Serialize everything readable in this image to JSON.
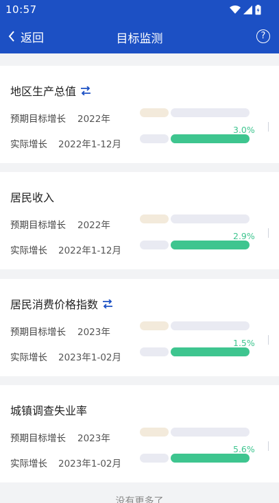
{
  "status_bar": {
    "time": "10:57"
  },
  "header": {
    "back_label": "返回",
    "title": "目标监测",
    "help_symbol": "?"
  },
  "colors": {
    "brand": "#1c50c4",
    "bar_fill": "#3ec58f",
    "target_track": "#f3eadb",
    "track": "#e9eaf2"
  },
  "cards": [
    {
      "title": "地区生产总值",
      "has_indicator": true,
      "target": {
        "label": "预期目标增长",
        "period": "2022年"
      },
      "actual": {
        "label": "实际增长",
        "period": "2022年1-12月",
        "value_text": "3.0%",
        "fill_fraction": 1.0
      }
    },
    {
      "title": "居民收入",
      "has_indicator": false,
      "target": {
        "label": "预期目标增长",
        "period": "2022年"
      },
      "actual": {
        "label": "实际增长",
        "period": "2022年1-12月",
        "value_text": "2.9%",
        "fill_fraction": 1.0
      }
    },
    {
      "title": "居民消费价格指数",
      "has_indicator": true,
      "target": {
        "label": "预期目标增长",
        "period": "2023年"
      },
      "actual": {
        "label": "实际增长",
        "period": "2023年1-02月",
        "value_text": "1.5%",
        "fill_fraction": 1.0
      }
    },
    {
      "title": "城镇调查失业率",
      "has_indicator": false,
      "target": {
        "label": "预期目标增长",
        "period": "2023年"
      },
      "actual": {
        "label": "实际增长",
        "period": "2023年1-02月",
        "value_text": "5.6%",
        "fill_fraction": 1.0
      }
    }
  ],
  "footer": {
    "text": "没有更多了"
  }
}
